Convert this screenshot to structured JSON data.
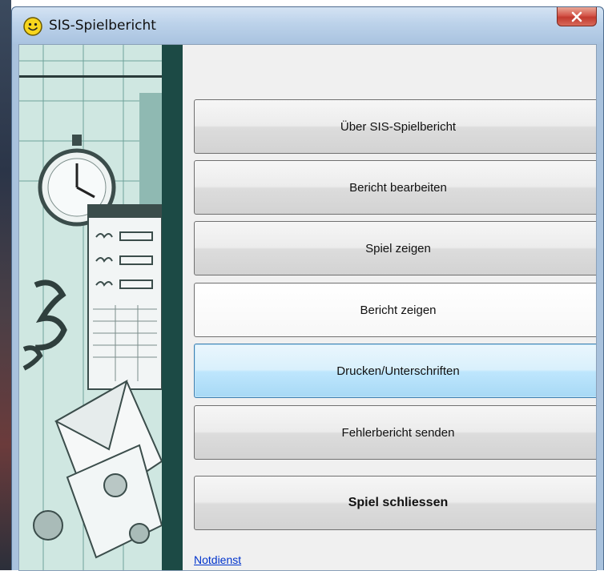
{
  "window": {
    "title": "SIS-Spielbericht",
    "icon": "smiley-icon",
    "close_icon": "close-icon"
  },
  "colors": {
    "titlebar": "#bcd2ea",
    "close_button": "#c23a2f",
    "artwork_band": "#1c4a45",
    "focus_border": "#3c7fb1",
    "link": "#0033cc"
  },
  "menu": {
    "about": "Über SIS-Spielbericht",
    "edit_report": "Bericht bearbeiten",
    "show_game": "Spiel zeigen",
    "show_report": "Bericht zeigen",
    "print_signatures": "Drucken/Unterschriften",
    "send_error_report": "Fehlerbericht senden",
    "close_game": "Spiel schliessen"
  },
  "footer": {
    "emergency_link": "Notdienst"
  }
}
